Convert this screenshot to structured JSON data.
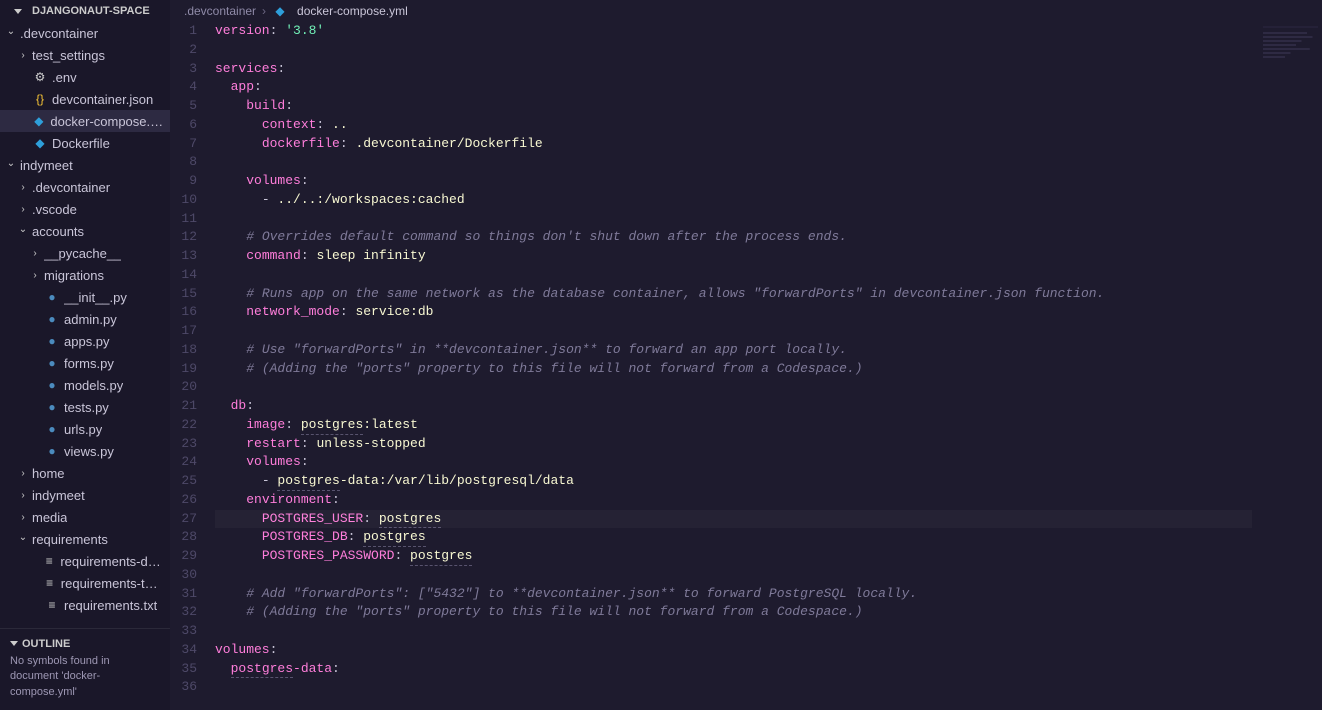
{
  "explorer": {
    "title": "DJANGONAUT-SPACE",
    "tree": [
      {
        "type": "folder",
        "label": ".devcontainer",
        "expanded": true,
        "depth": 0
      },
      {
        "type": "folder",
        "label": "test_settings",
        "expanded": false,
        "depth": 1
      },
      {
        "type": "file",
        "label": ".env",
        "icon": "env",
        "depth": 1
      },
      {
        "type": "file",
        "label": "devcontainer.json",
        "icon": "json",
        "depth": 1
      },
      {
        "type": "file",
        "label": "docker-compose.yml",
        "icon": "docker",
        "depth": 1,
        "selected": true
      },
      {
        "type": "file",
        "label": "Dockerfile",
        "icon": "docker",
        "depth": 1
      },
      {
        "type": "folder",
        "label": "indymeet",
        "expanded": true,
        "depth": 0
      },
      {
        "type": "folder",
        "label": ".devcontainer",
        "expanded": false,
        "depth": 1
      },
      {
        "type": "folder",
        "label": ".vscode",
        "expanded": false,
        "depth": 1
      },
      {
        "type": "folder",
        "label": "accounts",
        "expanded": true,
        "depth": 1
      },
      {
        "type": "folder",
        "label": "__pycache__",
        "expanded": false,
        "depth": 2
      },
      {
        "type": "folder",
        "label": "migrations",
        "expanded": false,
        "depth": 2
      },
      {
        "type": "file",
        "label": "__init__.py",
        "icon": "py",
        "depth": 2
      },
      {
        "type": "file",
        "label": "admin.py",
        "icon": "py",
        "depth": 2
      },
      {
        "type": "file",
        "label": "apps.py",
        "icon": "py",
        "depth": 2
      },
      {
        "type": "file",
        "label": "forms.py",
        "icon": "py",
        "depth": 2
      },
      {
        "type": "file",
        "label": "models.py",
        "icon": "py",
        "depth": 2
      },
      {
        "type": "file",
        "label": "tests.py",
        "icon": "py",
        "depth": 2
      },
      {
        "type": "file",
        "label": "urls.py",
        "icon": "py",
        "depth": 2
      },
      {
        "type": "file",
        "label": "views.py",
        "icon": "py",
        "depth": 2
      },
      {
        "type": "folder",
        "label": "home",
        "expanded": false,
        "depth": 1
      },
      {
        "type": "folder",
        "label": "indymeet",
        "expanded": false,
        "depth": 1
      },
      {
        "type": "folder",
        "label": "media",
        "expanded": false,
        "depth": 1
      },
      {
        "type": "folder",
        "label": "requirements",
        "expanded": true,
        "depth": 1
      },
      {
        "type": "file",
        "label": "requirements-dev.t...",
        "icon": "txt",
        "depth": 2
      },
      {
        "type": "file",
        "label": "requirements-test....",
        "icon": "txt",
        "depth": 2
      },
      {
        "type": "file",
        "label": "requirements.txt",
        "icon": "txt",
        "depth": 2
      }
    ]
  },
  "outline": {
    "title": "OUTLINE",
    "empty": "No symbols found in document 'docker-compose.yml'"
  },
  "breadcrumb": {
    "folder": ".devcontainer",
    "file": "docker-compose.yml"
  },
  "editor": {
    "highlightLine": 27,
    "lines": [
      [
        {
          "t": "key",
          "v": "version"
        },
        {
          "t": "p",
          "v": ": "
        },
        {
          "t": "str",
          "v": "'3.8'"
        }
      ],
      [],
      [
        {
          "t": "key",
          "v": "services"
        },
        {
          "t": "p",
          "v": ":"
        }
      ],
      [
        {
          "t": "sp",
          "v": "  "
        },
        {
          "t": "key",
          "v": "app"
        },
        {
          "t": "p",
          "v": ":"
        }
      ],
      [
        {
          "t": "sp",
          "v": "    "
        },
        {
          "t": "key",
          "v": "build"
        },
        {
          "t": "p",
          "v": ":"
        }
      ],
      [
        {
          "t": "sp",
          "v": "      "
        },
        {
          "t": "key",
          "v": "context"
        },
        {
          "t": "p",
          "v": ": "
        },
        {
          "t": "val",
          "v": ".."
        }
      ],
      [
        {
          "t": "sp",
          "v": "      "
        },
        {
          "t": "key",
          "v": "dockerfile"
        },
        {
          "t": "p",
          "v": ": "
        },
        {
          "t": "val",
          "v": ".devcontainer/Dockerfile"
        }
      ],
      [],
      [
        {
          "t": "sp",
          "v": "    "
        },
        {
          "t": "key",
          "v": "volumes"
        },
        {
          "t": "p",
          "v": ":"
        }
      ],
      [
        {
          "t": "sp",
          "v": "      "
        },
        {
          "t": "p",
          "v": "- "
        },
        {
          "t": "val",
          "v": "../..:/workspaces:cached"
        }
      ],
      [],
      [
        {
          "t": "sp",
          "v": "    "
        },
        {
          "t": "cmt",
          "v": "# Overrides default command so things don't shut down after the process ends."
        }
      ],
      [
        {
          "t": "sp",
          "v": "    "
        },
        {
          "t": "key",
          "v": "command"
        },
        {
          "t": "p",
          "v": ": "
        },
        {
          "t": "val",
          "v": "sleep infinity"
        }
      ],
      [],
      [
        {
          "t": "sp",
          "v": "    "
        },
        {
          "t": "cmt",
          "v": "# Runs app on the same network as the database container, allows \"forwardPorts\" in devcontainer.json function."
        }
      ],
      [
        {
          "t": "sp",
          "v": "    "
        },
        {
          "t": "key",
          "v": "network_mode"
        },
        {
          "t": "p",
          "v": ": "
        },
        {
          "t": "val",
          "v": "service:db"
        }
      ],
      [],
      [
        {
          "t": "sp",
          "v": "    "
        },
        {
          "t": "cmt",
          "v": "# Use \"forwardPorts\" in **devcontainer.json** to forward an app port locally."
        }
      ],
      [
        {
          "t": "sp",
          "v": "    "
        },
        {
          "t": "cmt",
          "v": "# (Adding the \"ports\" property to this file will not forward from a Codespace.)"
        }
      ],
      [],
      [
        {
          "t": "sp",
          "v": "  "
        },
        {
          "t": "key",
          "v": "db"
        },
        {
          "t": "p",
          "v": ":"
        }
      ],
      [
        {
          "t": "sp",
          "v": "    "
        },
        {
          "t": "key",
          "v": "image"
        },
        {
          "t": "p",
          "v": ": "
        },
        {
          "t": "valul",
          "v": "postgres"
        },
        {
          "t": "val",
          "v": ":latest"
        }
      ],
      [
        {
          "t": "sp",
          "v": "    "
        },
        {
          "t": "key",
          "v": "restart"
        },
        {
          "t": "p",
          "v": ": "
        },
        {
          "t": "val",
          "v": "unless-stopped"
        }
      ],
      [
        {
          "t": "sp",
          "v": "    "
        },
        {
          "t": "key",
          "v": "volumes"
        },
        {
          "t": "p",
          "v": ":"
        }
      ],
      [
        {
          "t": "sp",
          "v": "      "
        },
        {
          "t": "p",
          "v": "- "
        },
        {
          "t": "valul",
          "v": "postgres"
        },
        {
          "t": "val",
          "v": "-data:/var/lib/postgresql/data"
        }
      ],
      [
        {
          "t": "sp",
          "v": "    "
        },
        {
          "t": "key",
          "v": "environment"
        },
        {
          "t": "p",
          "v": ":"
        }
      ],
      [
        {
          "t": "sp",
          "v": "      "
        },
        {
          "t": "key",
          "v": "POSTGRES_USER"
        },
        {
          "t": "p",
          "v": ": "
        },
        {
          "t": "valul",
          "v": "postgres"
        }
      ],
      [
        {
          "t": "sp",
          "v": "      "
        },
        {
          "t": "key",
          "v": "POSTGRES_DB"
        },
        {
          "t": "p",
          "v": ": "
        },
        {
          "t": "valul",
          "v": "postgres"
        }
      ],
      [
        {
          "t": "sp",
          "v": "      "
        },
        {
          "t": "key",
          "v": "POSTGRES_PASSWORD"
        },
        {
          "t": "p",
          "v": ": "
        },
        {
          "t": "valul",
          "v": "postgres"
        }
      ],
      [],
      [
        {
          "t": "sp",
          "v": "    "
        },
        {
          "t": "cmt",
          "v": "# Add \"forwardPorts\": [\"5432\"] to **devcontainer.json** to forward PostgreSQL locally."
        }
      ],
      [
        {
          "t": "sp",
          "v": "    "
        },
        {
          "t": "cmt",
          "v": "# (Adding the \"ports\" property to this file will not forward from a Codespace.)"
        }
      ],
      [],
      [
        {
          "t": "key",
          "v": "volumes"
        },
        {
          "t": "p",
          "v": ":"
        }
      ],
      [
        {
          "t": "sp",
          "v": "  "
        },
        {
          "t": "keyul",
          "v": "postgres"
        },
        {
          "t": "key",
          "v": "-data"
        },
        {
          "t": "p",
          "v": ":"
        }
      ],
      []
    ]
  }
}
